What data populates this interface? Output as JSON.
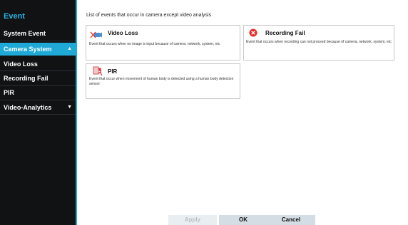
{
  "sidebar": {
    "title": "Event",
    "items": [
      {
        "label": "System Event"
      },
      {
        "label": "Camera System",
        "chevron": "▲"
      },
      {
        "label": "Video Loss"
      },
      {
        "label": "Recording Fail"
      },
      {
        "label": "PIR"
      },
      {
        "label": "Video-Analytics",
        "chevron": "▼"
      }
    ]
  },
  "main": {
    "description": "List of events that occur in camera except video analysis",
    "cards": [
      {
        "title": "Video Loss",
        "description": "Event that occurs when no image is input because of camera, network, system, etc",
        "icon": "video-loss-icon"
      },
      {
        "title": "Recording Fail",
        "description": "Event that occurs when recording can not proceed because of camera, network, system, etc",
        "icon": "recording-fail-icon"
      },
      {
        "title": "PIR",
        "description": "Event that occur when movement of human body is detected using a human body detection sensor",
        "icon": "pir-icon"
      }
    ]
  },
  "footer": {
    "apply_label": "Apply",
    "ok_label": "OK",
    "cancel_label": "Cancel"
  },
  "colors": {
    "accent": "#1ea9d6",
    "sidebar_bg": "#101214",
    "error_red": "#e0302b"
  }
}
